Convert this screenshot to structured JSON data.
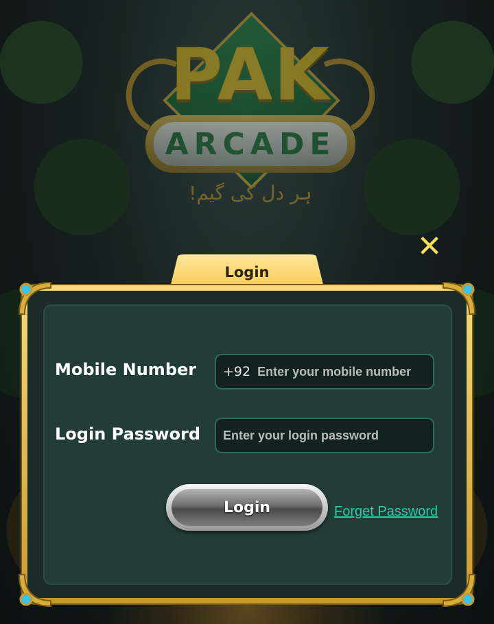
{
  "logo": {
    "title": "PAK",
    "subtitle": "ARCADE",
    "tagline": "ہر دل کی گیم!"
  },
  "dialog": {
    "tab_title": "Login",
    "mobile": {
      "label": "Mobile Number",
      "prefix": "+92",
      "placeholder": "Enter your mobile number"
    },
    "password": {
      "label": "Login Password",
      "placeholder": "Enter your login password"
    },
    "login_button": "Login",
    "forget_password": "Forget Password"
  },
  "colors": {
    "accent": "#f7c84f",
    "link": "#2ec9a6",
    "panel": "#223d37"
  },
  "icons": {
    "close": "close-icon"
  }
}
